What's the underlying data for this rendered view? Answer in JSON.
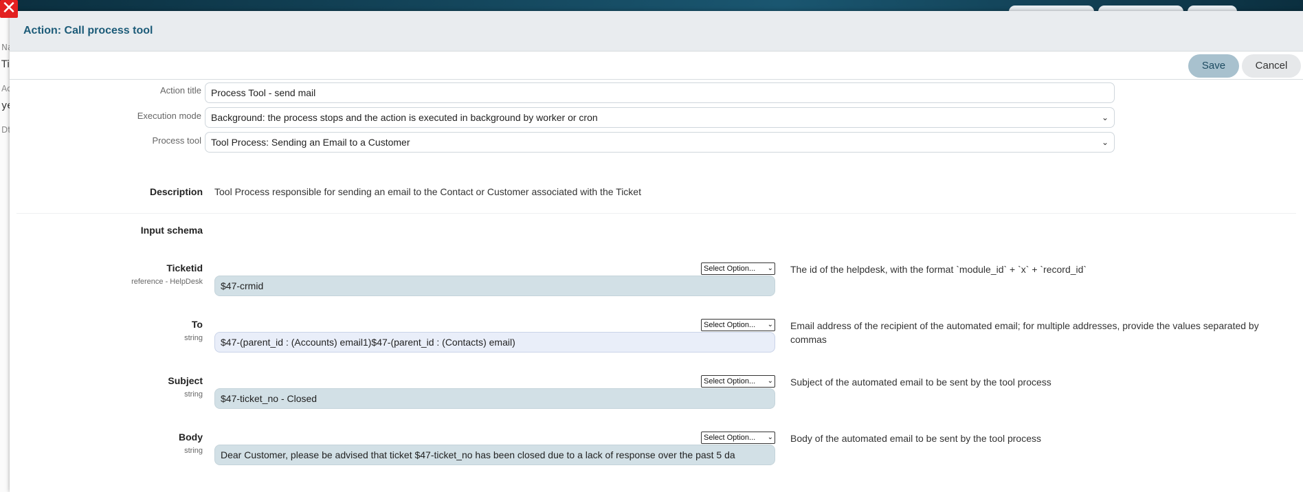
{
  "modal": {
    "title": "Action: Call process tool",
    "save_label": "Save",
    "cancel_label": "Cancel"
  },
  "form": {
    "action_title_label": "Action title",
    "action_title_value": "Process Tool - send mail",
    "execution_mode_label": "Execution mode",
    "execution_mode_value": "Background: the process stops and the action is executed in background by worker or cron",
    "process_tool_label": "Process tool",
    "process_tool_value": "Tool Process: Sending an Email to a Customer"
  },
  "description": {
    "label": "Description",
    "text": "Tool Process responsible for sending an email to the Contact or Customer associated with the Ticket"
  },
  "input_schema": {
    "label": "Input schema",
    "select_placeholder": "Select Option...",
    "params": [
      {
        "name": "Ticketid",
        "type": "reference - HelpDesk",
        "value": "$47-crmid",
        "description": "The id of the helpdesk, with the format `module_id` + `x` + `record_id`"
      },
      {
        "name": "To",
        "type": "string",
        "value": "$47-(parent_id : (Accounts) email1)$47-(parent_id : (Contacts) email)",
        "description": "Email address of the recipient of the automated email; for multiple addresses, provide the values separated by commas"
      },
      {
        "name": "Subject",
        "type": "string",
        "value": "$47-ticket_no - Closed",
        "description": "Subject of the automated email to be sent by the tool process"
      },
      {
        "name": "Body",
        "type": "string",
        "value": "Dear Customer, please be advised that ticket $47-ticket_no has been closed due to a lack of response over the past 5 da",
        "description": "Body of the automated email to be sent by the tool process"
      }
    ]
  },
  "background": {
    "left_fragments": [
      "Na",
      "Ti",
      "Ac",
      "ye",
      "Dt"
    ]
  }
}
